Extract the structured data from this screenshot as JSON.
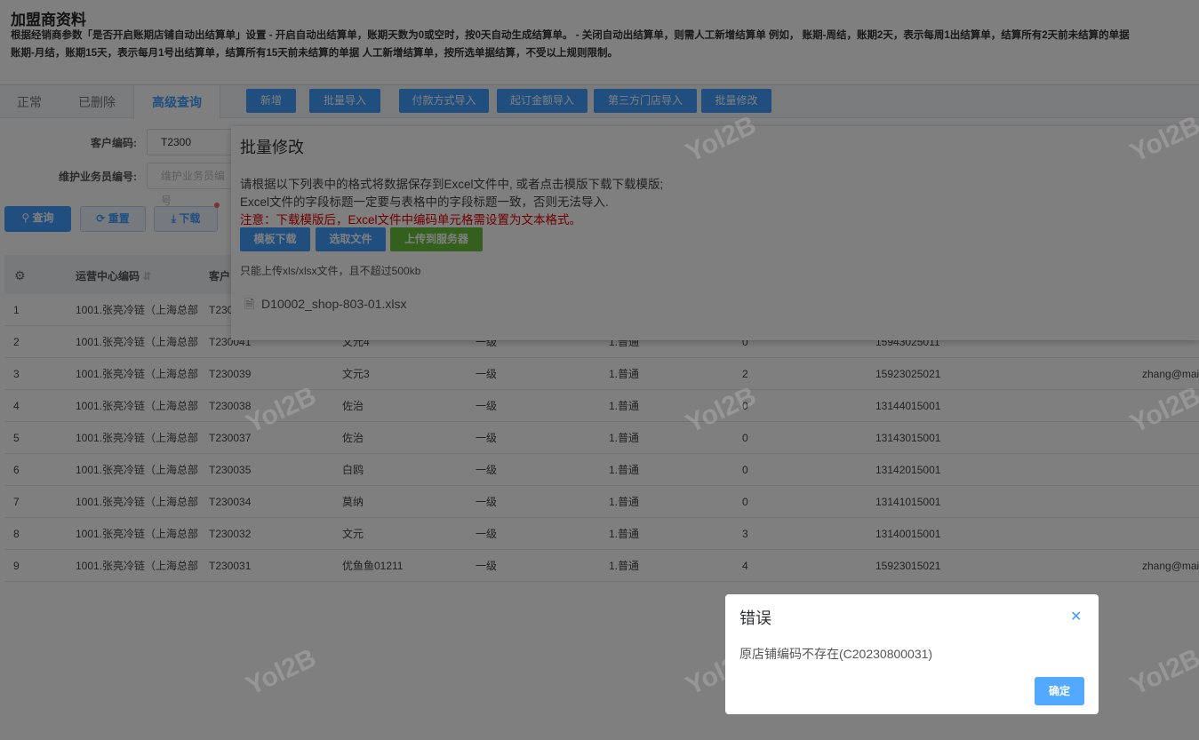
{
  "page": {
    "title": "加盟商资料",
    "desc": [
      "根据经销商参数「是否开启账期店铺自动出结算单」设置 - 开启自动出结算单，账期天数为0或空时，按0天自动生成结算单。 - 关闭自动出结算单，则需人工新增结算单 例如， 账期-周结，账期2天，表示每周1出结算单，结算所有2天前未结算的单据",
      "账期-月结，账期15天，表示每月1号出结算单，结算所有15天前未结算的单据 人工新增结算单，按所选单据结算，不受以上规则限制。"
    ]
  },
  "tabs": [
    "正常",
    "已删除",
    "高级查询"
  ],
  "toolbar": [
    "新增",
    "批量导入",
    "付款方式导入",
    "起订金额导入",
    "第三方门店导入",
    "批量修改"
  ],
  "form": {
    "customer_code_label": "客户编码:",
    "customer_code_value": "T2300",
    "staff_label": "维护业务员编号:",
    "staff_placeholder": "维护业务员编号"
  },
  "actions": {
    "search": "查询",
    "reset": "重置",
    "download": "下载"
  },
  "table": {
    "headers": [
      "运营中心编码",
      "客户"
    ],
    "rows": [
      [
        "1",
        "1001.张亮冷链（上海总部",
        "T230",
        "",
        "",
        "",
        "",
        ""
      ],
      [
        "2",
        "1001.张亮冷链（上海总部",
        "T230041",
        "文元4",
        "一级",
        "1.普通",
        "0",
        "15943025011",
        ""
      ],
      [
        "3",
        "1001.张亮冷链（上海总部",
        "T230039",
        "文元3",
        "一级",
        "1.普通",
        "2",
        "15923025021",
        "zhang@mai"
      ],
      [
        "4",
        "1001.张亮冷链（上海总部",
        "T230038",
        "佐治",
        "一级",
        "1.普通",
        "0",
        "13144015001",
        ""
      ],
      [
        "5",
        "1001.张亮冷链（上海总部",
        "T230037",
        "佐治",
        "一级",
        "1.普通",
        "0",
        "13143015001",
        ""
      ],
      [
        "6",
        "1001.张亮冷链（上海总部",
        "T230035",
        "白鸥",
        "一级",
        "1.普通",
        "0",
        "13142015001",
        ""
      ],
      [
        "7",
        "1001.张亮冷链（上海总部",
        "T230034",
        "莫纳",
        "一级",
        "1.普通",
        "0",
        "13141015001",
        ""
      ],
      [
        "8",
        "1001.张亮冷链（上海总部",
        "T230032",
        "文元",
        "一级",
        "1.普通",
        "3",
        "13140015001",
        ""
      ],
      [
        "9",
        "1001.张亮冷链（上海总部",
        "T230031",
        "优鱼鱼01211",
        "一级",
        "1.普通",
        "4",
        "15923015021",
        "zhang@mai"
      ]
    ]
  },
  "panel": {
    "title": "批量修改",
    "line1": "请根据以下列表中的格式将数据保存到Excel文件中, 或者点击模版下载下载模版;",
    "line2": "Excel文件的字段标题一定要与表格中的字段标题一致，否则无法导入.",
    "warning": "注意：下载模版后，Excel文件中编码单元格需设置为文本格式。",
    "btn_template": "模板下载",
    "btn_select": "选取文件",
    "btn_upload": "上传到服务器",
    "hint": "只能上传xls/xlsx文件，且不超过500kb",
    "file": "D10002_shop-803-01.xlsx"
  },
  "dialog": {
    "title": "错误",
    "message": "原店铺编码不存在(C20230800031)",
    "confirm": "确定"
  },
  "watermark": "Yol2B",
  "colors": {
    "primary": "#409eff",
    "success": "#67c23a",
    "danger": "#e00000"
  }
}
